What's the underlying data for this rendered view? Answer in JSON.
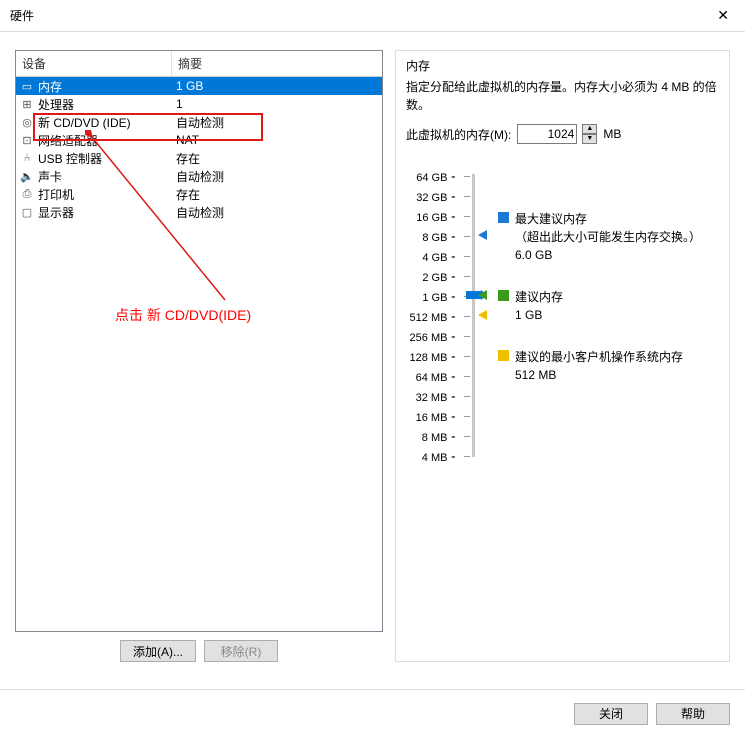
{
  "window": {
    "title": "硬件"
  },
  "list": {
    "headers": {
      "device": "设备",
      "summary": "摘要"
    },
    "rows": [
      {
        "icon": "memory-icon",
        "glyph": "▭",
        "name": "内存",
        "summary": "1 GB",
        "selected": true
      },
      {
        "icon": "cpu-icon",
        "glyph": "⊞",
        "name": "处理器",
        "summary": "1"
      },
      {
        "icon": "cd-icon",
        "glyph": "◎",
        "name": "新 CD/DVD (IDE)",
        "summary": "自动检测"
      },
      {
        "icon": "network-icon",
        "glyph": "⊡",
        "name": "网络适配器",
        "summary": "NAT"
      },
      {
        "icon": "usb-icon",
        "glyph": "⑃",
        "name": "USB 控制器",
        "summary": "存在"
      },
      {
        "icon": "sound-icon",
        "glyph": "🔈",
        "name": "声卡",
        "summary": "自动检测"
      },
      {
        "icon": "printer-icon",
        "glyph": "⎙",
        "name": "打印机",
        "summary": "存在"
      },
      {
        "icon": "display-icon",
        "glyph": "▢",
        "name": "显示器",
        "summary": "自动检测"
      }
    ]
  },
  "buttons": {
    "add": "添加(A)...",
    "remove": "移除(R)",
    "close": "关闭",
    "help": "帮助"
  },
  "annotation": {
    "text": "点击 新 CD/DVD(IDE)"
  },
  "memory": {
    "title": "内存",
    "desc": "指定分配给此虚拟机的内存量。内存大小必须为 4 MB 的倍数。",
    "label": "此虚拟机的内存(M):",
    "value": "1024",
    "unit": "MB",
    "ticks": [
      "64 GB",
      "32 GB",
      "16 GB",
      "8 GB",
      "4 GB",
      "2 GB",
      "1 GB",
      "512 MB",
      "256 MB",
      "128 MB",
      "64 MB",
      "32 MB",
      "16 MB",
      "8 MB",
      "4 MB"
    ],
    "legend": {
      "max": {
        "label": "最大建议内存",
        "note": "（超出此大小可能发生内存交换。）",
        "value": "6.0 GB"
      },
      "rec": {
        "label": "建议内存",
        "value": "1 GB"
      },
      "min": {
        "label": "建议的最小客户机操作系统内存",
        "value": "512 MB"
      }
    }
  }
}
